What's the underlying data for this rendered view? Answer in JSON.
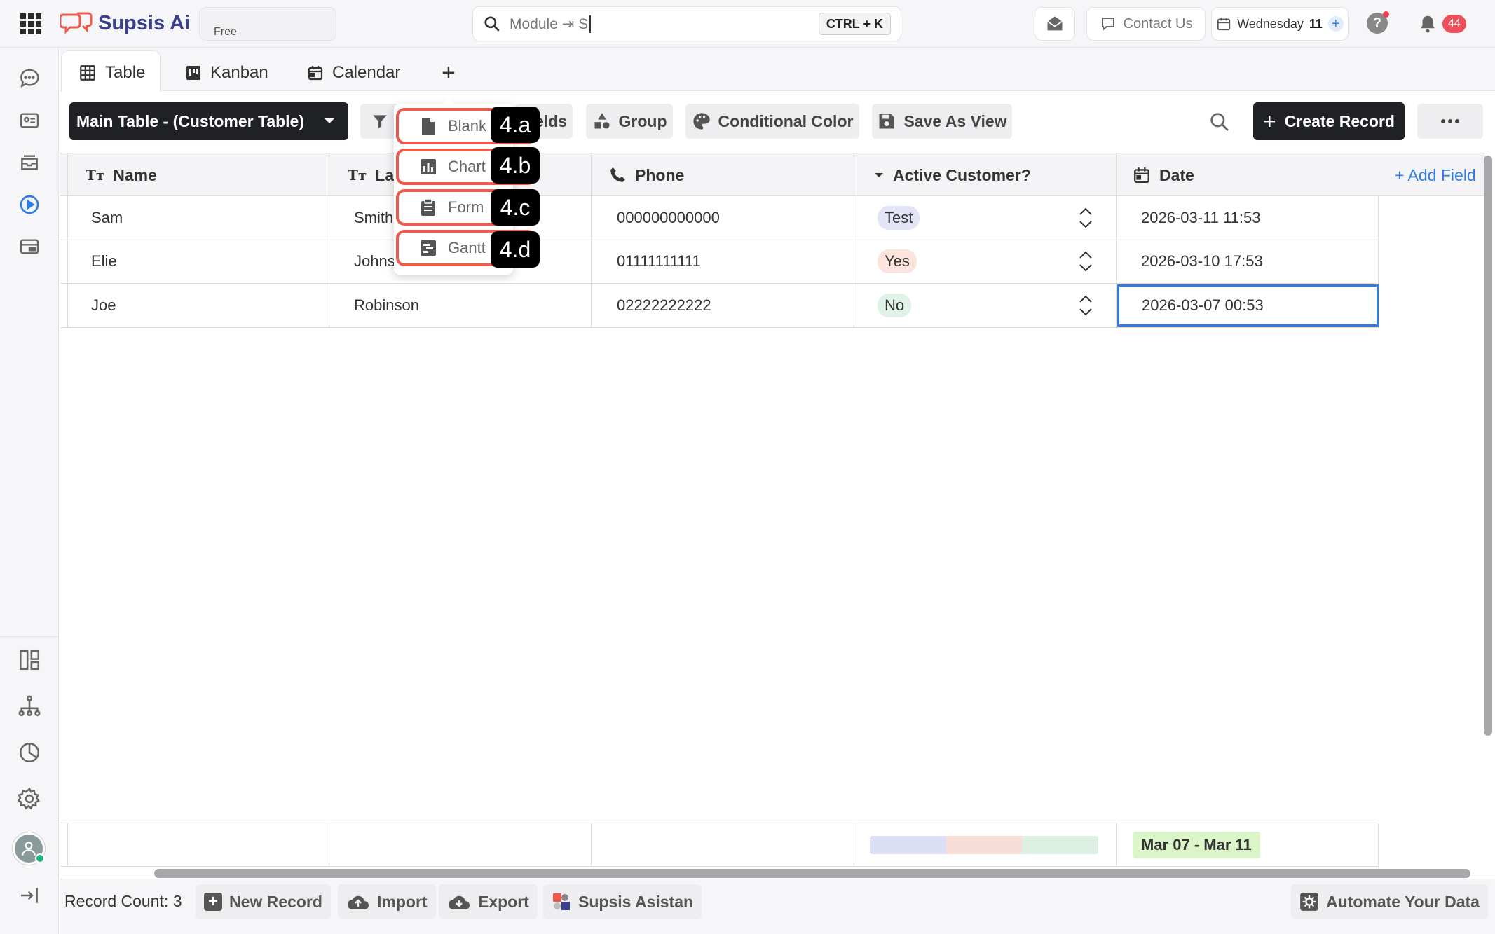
{
  "app": {
    "name": "Supsis Ai",
    "plan": "Free"
  },
  "topbar": {
    "search_text": "Module ⇥ S",
    "shortcut": "CTRL + K",
    "contact_label": "Contact Us",
    "date_day": "Wednesday",
    "date_num": "11",
    "notifications": "44"
  },
  "tabs": [
    {
      "label": "Table"
    },
    {
      "label": "Kanban"
    },
    {
      "label": "Calendar"
    }
  ],
  "toolbar": {
    "table_select": "Main Table - (Customer Table)",
    "fields_partial": "elds",
    "group": "Group",
    "conditional_color": "Conditional Color",
    "save_as_view": "Save As View",
    "create_record": "Create Record"
  },
  "dropdown": {
    "items": [
      {
        "label": "Blank",
        "tag": "4.a"
      },
      {
        "label": "Chart",
        "tag": "4.b"
      },
      {
        "label": "Form",
        "tag": "4.c"
      },
      {
        "label": "Gantt",
        "tag": "4.d"
      }
    ]
  },
  "table": {
    "columns": [
      "Name",
      "Las",
      "Phone",
      "Active Customer?",
      "Date"
    ],
    "add_field": "+ Add Field",
    "rows": [
      {
        "name": "Sam",
        "last": "Smith",
        "phone": "000000000000",
        "active": "Test",
        "date": "2026-03-11 11:53"
      },
      {
        "name": "Elie",
        "last": "Johns",
        "phone": "01111111111",
        "active": "Yes",
        "date": "2026-03-10 17:53"
      },
      {
        "name": "Joe",
        "last": "Robinson",
        "phone": "02222222222",
        "active": "No",
        "date": "2026-03-07 00:53"
      }
    ],
    "summary_date_range": "Mar 07 - Mar 11"
  },
  "footer": {
    "record_count": "Record Count: 3",
    "new_record": "New Record",
    "import": "Import",
    "export": "Export",
    "asistan": "Supsis Asistan",
    "automate": "Automate Your Data"
  },
  "colors": {
    "accent": "#2f7de1",
    "dark": "#1f2124",
    "highlight": "#ee5a4e",
    "badge_test": "#e3e4f6",
    "badge_yes": "#fbe3de",
    "badge_no": "#e1f3e9",
    "date_range_bg": "#dcf5c8"
  }
}
